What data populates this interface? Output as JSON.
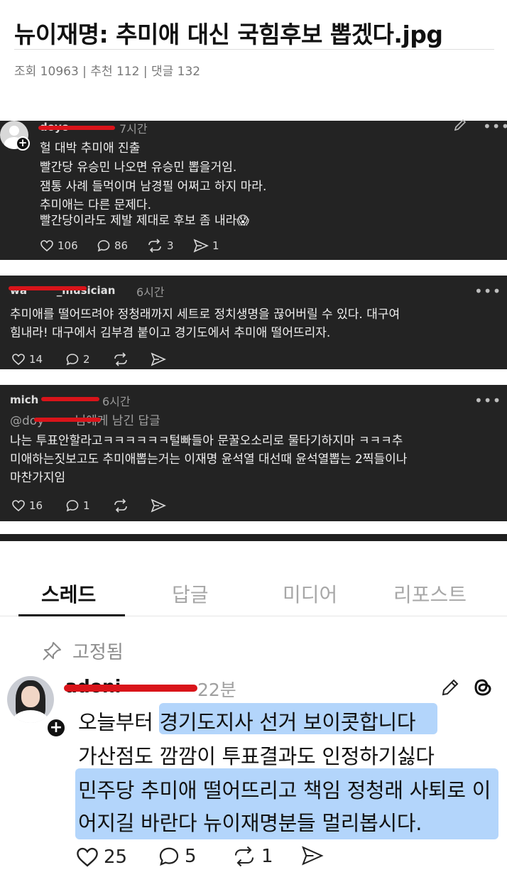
{
  "post": {
    "title": "뉴이재명: 추미애 대신 국힘후보 뽑겠다.jpg",
    "meta": "조회 10963 | 추천 112 | 댓글 132"
  },
  "comments": [
    {
      "username": "doyo",
      "time": "7시간",
      "lines": [
        "헐 대박 추미애 진출",
        "빨간당 유승민 나오면 유승민 뽑을거임.",
        "잼통 사례 들먹이며 남경필 어쩌고 하지 마라.",
        "추미애는 다른 문제다.",
        "빨간당이라도 제발 제대로 후보 좀 내라😱"
      ],
      "likes": "106",
      "replies": "86",
      "reposts": "3",
      "shares": "1"
    },
    {
      "username": "wa        _musician",
      "time": "6시간",
      "lines": [
        "추미애를 떨어뜨려야 정청래까지 세트로 정치생명을 끊어버릴 수 있다. 대구여",
        "힘내라! 대구에서 김부겸 붙이고 경기도에서 추미애 떨어뜨리자."
      ],
      "likes": "14",
      "replies": "2"
    },
    {
      "username": "mich",
      "time": "6시간",
      "reply_to": "@doy        님에게 남긴 답글",
      "lines": [
        "나는 투표안할라고ㅋㅋㅋㅋㅋㅋ털빠들아 문꿀오소리로 물타기하지마 ㅋㅋㅋ추",
        "미애하는짓보고도 추미애뽑는거는 이재명 윤석열 대선때 윤석열뽑는 2찍들이나",
        "마찬가지임"
      ],
      "likes": "16",
      "replies": "1"
    }
  ],
  "threads": {
    "tabs": [
      "스레드",
      "답글",
      "미디어",
      "리포스트"
    ],
    "pinned_label": "고정됨",
    "username": "adoni",
    "time": "22분",
    "lines": [
      "오늘부터 경기도지사 선거 보이콧합니다",
      "가산점도 깜깜이 투표결과도 인정하기싫다",
      "민주당 추미애 떨어뜨리고 책임 정청래 사퇴로 이",
      "어지길 바란다 뉴이재명분들 멀리봅시다."
    ],
    "likes": "25",
    "replies": "5",
    "reposts": "1"
  },
  "colors": {
    "dark_bg": "#232323",
    "redaction": "#d9141a",
    "highlight": "#b3d5fb"
  }
}
